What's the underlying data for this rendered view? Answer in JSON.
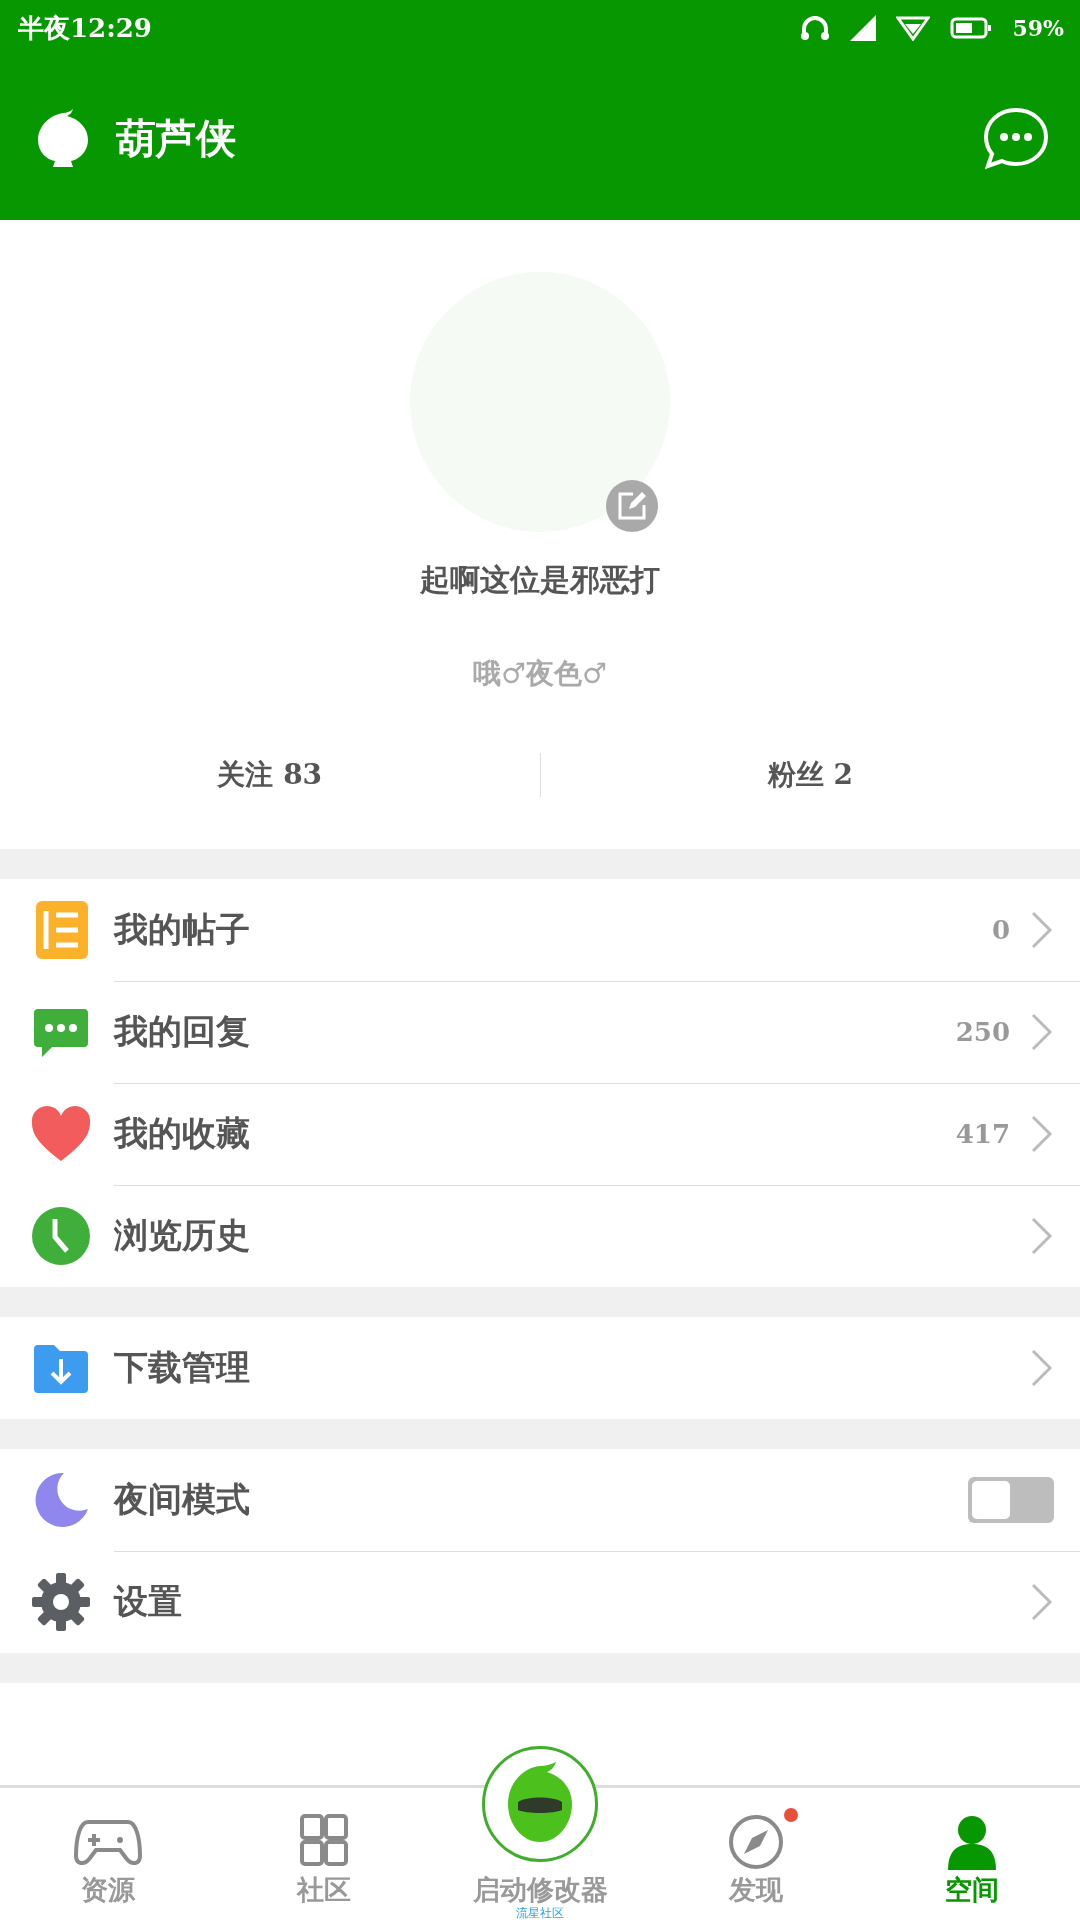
{
  "status_bar": {
    "time": "半夜12:29",
    "battery": "59%"
  },
  "header": {
    "title": "葫芦侠"
  },
  "profile": {
    "name": "起啊这位是邪恶打",
    "signature": "哦♂夜色♂"
  },
  "stats": [
    {
      "label": "关注",
      "value": "83"
    },
    {
      "label": "粉丝",
      "value": "2"
    }
  ],
  "menu_groups": [
    [
      {
        "kind": "posts",
        "label": "我的帖子",
        "count": "0"
      },
      {
        "kind": "replies",
        "label": "我的回复",
        "count": "250"
      },
      {
        "kind": "favorites",
        "label": "我的收藏",
        "count": "417"
      },
      {
        "kind": "history",
        "label": "浏览历史"
      }
    ],
    [
      {
        "kind": "download",
        "label": "下载管理"
      }
    ],
    [
      {
        "kind": "night",
        "label": "夜间模式",
        "on": false
      },
      {
        "kind": "settings",
        "label": "设置"
      }
    ]
  ],
  "bottom_nav": [
    {
      "kind": "game",
      "label": "资源",
      "selected": false,
      "badge": false
    },
    {
      "kind": "grid",
      "label": "社区",
      "selected": false,
      "badge": false
    },
    {
      "kind": "center",
      "label": "启动修改器",
      "sublabel": "流星社区"
    },
    {
      "kind": "compass",
      "label": "发现",
      "selected": false,
      "badge": true
    },
    {
      "kind": "person",
      "label": "空间",
      "selected": true,
      "badge": false
    }
  ]
}
